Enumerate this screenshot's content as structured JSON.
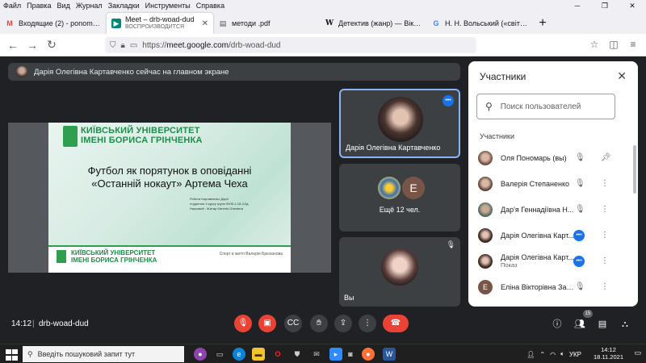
{
  "menubar": {
    "items": [
      "Файл",
      "Правка",
      "Вид",
      "Журнал",
      "Закладки",
      "Инструменты",
      "Справка"
    ]
  },
  "tabs": [
    {
      "label": "Входящие (2) - ponomar.olka",
      "icon": "gmail-icon",
      "active": false
    },
    {
      "label": "Meet – drb-woad-dud",
      "sublabel": "ВОСПРОИЗВОДИТСЯ",
      "icon": "meet-icon",
      "active": true
    },
    {
      "label": "методи .pdf",
      "icon": "pdf-icon",
      "active": false
    },
    {
      "label": "Детектив (жанр) — Вікіпедія",
      "icon": "wikipedia-icon",
      "active": false
    },
    {
      "label": "Н. Н. Вольський («світ детекти",
      "icon": "google-icon",
      "active": false
    }
  ],
  "url": {
    "prefix": "https://",
    "host": "meet.google.com",
    "path": "/drb-woad-dud"
  },
  "presenter": {
    "text": "Дарія Олегівна Картавченко сейчас на главном экране"
  },
  "slide": {
    "university": "КИЇВСЬКИЙ УНІВЕРСИТЕТ\nІМЕНІ БОРИСА ГРІНЧЕНКА",
    "title": "Футбол як порятунок в оповіданні\n«Останній нокаут» Артема Чеха",
    "info": "Робота Картавченко Дарії\nстудентки 4 курсу групи ФіЛб-1-18-4.0д\nНауковий : Житар Євгенія Олегівна",
    "next_university": "КИЇВСЬКИЙ УНІВЕРСИТЕТ\nІМЕНІ БОРИСА ГРІНЧЕНКА",
    "next_right": "Спорт в житті Валерія Брюханова"
  },
  "tiles": {
    "main_name": "Дарія Олегівна Картавченко",
    "others_label": "Ещё 12 чел.",
    "others_initial": "Е",
    "self_name": "Вы"
  },
  "panel": {
    "title": "Участники",
    "search_placeholder": "Поиск пользователей",
    "section": "Участники",
    "participants": [
      {
        "name": "Оля Пономарь (вы)",
        "sub": "",
        "avatar": "photo",
        "color": "#8d6e63",
        "mic": "muted",
        "action": "pin"
      },
      {
        "name": "Валерія Степаненко",
        "sub": "",
        "avatar": "photo",
        "color": "#6d4c41",
        "mic": "muted",
        "action": "more"
      },
      {
        "name": "Дар'я Геннадіївна Н...",
        "sub": "",
        "avatar": "photo",
        "color": "#4e6b5a",
        "mic": "muted",
        "action": "more"
      },
      {
        "name": "Дарія Олегівна Карт...",
        "sub": "",
        "avatar": "photo",
        "color": "#3e2a25",
        "mic": "speaking",
        "action": "more"
      },
      {
        "name": "Дарія Олегівна Карт...",
        "sub": "Показ",
        "avatar": "photo",
        "color": "#3e2a25",
        "mic": "presenting",
        "action": "more"
      },
      {
        "name": "Еліна Вікторівна Зад...",
        "sub": "",
        "avatar": "letter",
        "initial": "Е",
        "color": "#795548",
        "mic": "muted",
        "action": "more"
      }
    ]
  },
  "bottombar": {
    "time": "14:12",
    "separator": "|",
    "meeting_code": "drb-woad-dud",
    "participant_count": "15"
  },
  "taskbar": {
    "search_placeholder": "Введіть пошуковий запит тут",
    "lang": "УКР",
    "time": "14:12",
    "date": "18.11.2021"
  },
  "colors": {
    "accent": "#1a73e8",
    "danger": "#ea4335",
    "meet_bg": "#202124",
    "tile_bg": "#3c4043",
    "uni_green": "#1e8e49"
  }
}
